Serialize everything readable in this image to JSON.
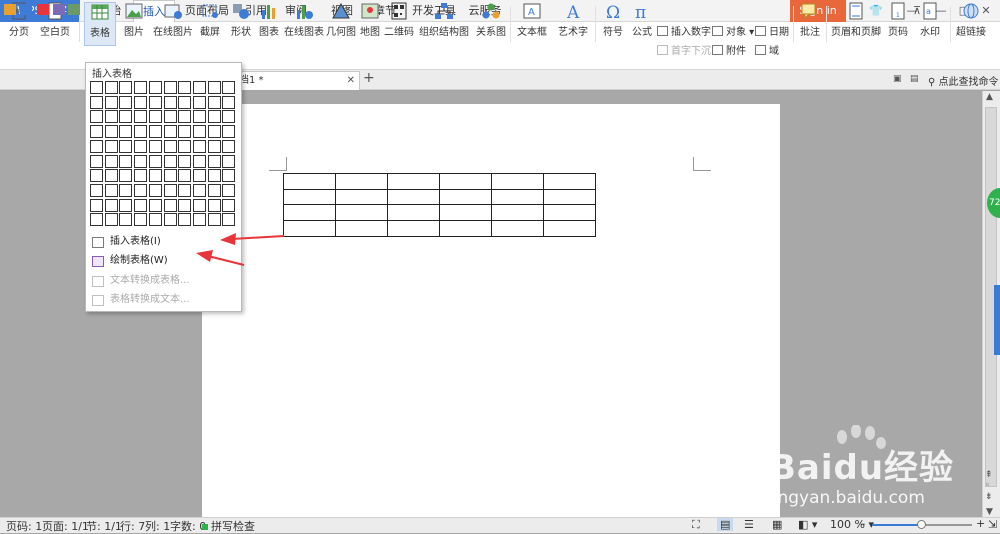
{
  "app": {
    "name": "WPS 文字",
    "sign_in": "Sign in"
  },
  "menu_tabs": [
    "开始",
    "插入",
    "页面布局",
    "引用",
    "审阅",
    "视图",
    "章节",
    "开发工具",
    "云服务"
  ],
  "active_tab": "插入",
  "window_controls": [
    "⚙",
    "👕",
    "?",
    "—",
    "⊼",
    "—",
    "□",
    "✕"
  ],
  "ribbon": {
    "buttons": [
      "分页",
      "空白页",
      "表格",
      "图片",
      "在线图片",
      "截屏",
      "形状",
      "图表",
      "在线图表",
      "几何图",
      "地图",
      "二维码",
      "组织结构图",
      "关系图",
      "文本框",
      "艺术字",
      "符号",
      "公式"
    ],
    "small": {
      "insert_number": "插入数字",
      "object": "对象",
      "date": "日期",
      "first_drop": "首字下沉",
      "attachment": "附件",
      "field": "域"
    },
    "right_buttons": [
      "批注",
      "页眉和页脚",
      "页码",
      "水印",
      "超链接"
    ]
  },
  "document": {
    "tab_label": "档1 *",
    "find_command": "点此查找命令"
  },
  "table_menu": {
    "title": "插入表格",
    "grid_cols": 10,
    "grid_rows": 10,
    "items": [
      {
        "label": "插入表格(I)",
        "disabled": false
      },
      {
        "label": "绘制表格(W)",
        "disabled": false
      },
      {
        "label": "文本转换成表格...",
        "disabled": true
      },
      {
        "label": "表格转换成文本...",
        "disabled": true
      }
    ]
  },
  "doc_table": {
    "rows": 4,
    "cols": 6
  },
  "side_badge": "72",
  "status": {
    "page": "页码: 1",
    "pages": "页面: 1/1",
    "section": "节: 1/1",
    "row": "行: 7",
    "col": "列: 1",
    "words": "字数: 0",
    "spell": "拼写检查",
    "zoom": "100 %"
  },
  "watermark": {
    "text": "Baidu经验",
    "url": "jingyan.baidu.com"
  },
  "colors": {
    "accent": "#3d7bd7",
    "signin": "#e8673b",
    "arrow": "#e8353b"
  }
}
